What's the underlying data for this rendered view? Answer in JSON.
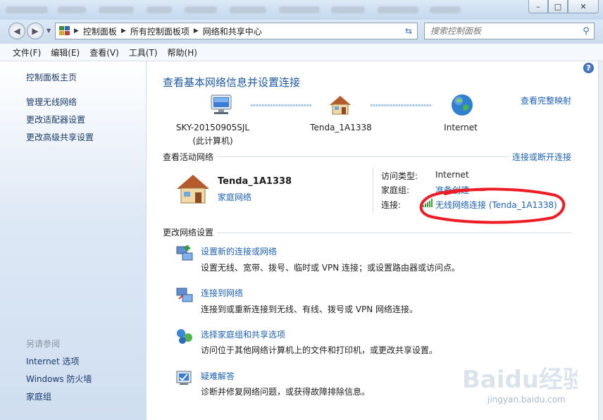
{
  "window_controls": {
    "minimize": "–",
    "maximize": "□",
    "close": "✕"
  },
  "address_bar": {
    "crumbs": [
      "控制面板",
      "所有控制面板项",
      "网络和共享中心"
    ]
  },
  "search": {
    "placeholder": "搜索控制面板"
  },
  "menu": [
    "文件(F)",
    "编辑(E)",
    "查看(V)",
    "工具(T)",
    "帮助(H)"
  ],
  "sidebar": {
    "home": "控制面板主页",
    "items": [
      "管理无线网络",
      "更改适配器设置",
      "更改高级共享设置"
    ],
    "see_also_title": "另请参阅",
    "see_also": [
      "Internet 选项",
      "Windows 防火墙",
      "家庭组"
    ]
  },
  "main": {
    "title": "查看基本网络信息并设置连接",
    "view_full_map": "查看完整映射",
    "map": {
      "computer_name": "SKY-20150905SJL",
      "computer_sub": "(此计算机)",
      "network_name": "Tenda_1A1338",
      "internet": "Internet"
    },
    "active_section": "查看活动网络",
    "connect_disconnect": "连接或断开连接",
    "active": {
      "name": "Tenda_1A1338",
      "type": "家庭网络",
      "access_label": "访问类型:",
      "access_value": "Internet",
      "homegroup_label": "家庭组:",
      "homegroup_value": "准备创建",
      "conn_label": "连接:",
      "conn_value": "无线网络连接 (Tenda_1A1338)"
    },
    "change_section": "更改网络设置",
    "tasks": [
      {
        "title": "设置新的连接或网络",
        "desc": "设置无线、宽带、拨号、临时或 VPN 连接；或设置路由器或访问点。"
      },
      {
        "title": "连接到网络",
        "desc": "连接到或重新连接到无线、有线、拨号或 VPN 网络连接。"
      },
      {
        "title": "选择家庭组和共享选项",
        "desc": "访问位于其他网络计算机上的文件和打印机，或更改共享设置。"
      },
      {
        "title": "疑难解答",
        "desc": "诊断并修复网络问题，或获得故障排除信息。"
      }
    ]
  },
  "watermark": {
    "logo": "Baidu经验",
    "url": "jingyan.baidu.com"
  }
}
